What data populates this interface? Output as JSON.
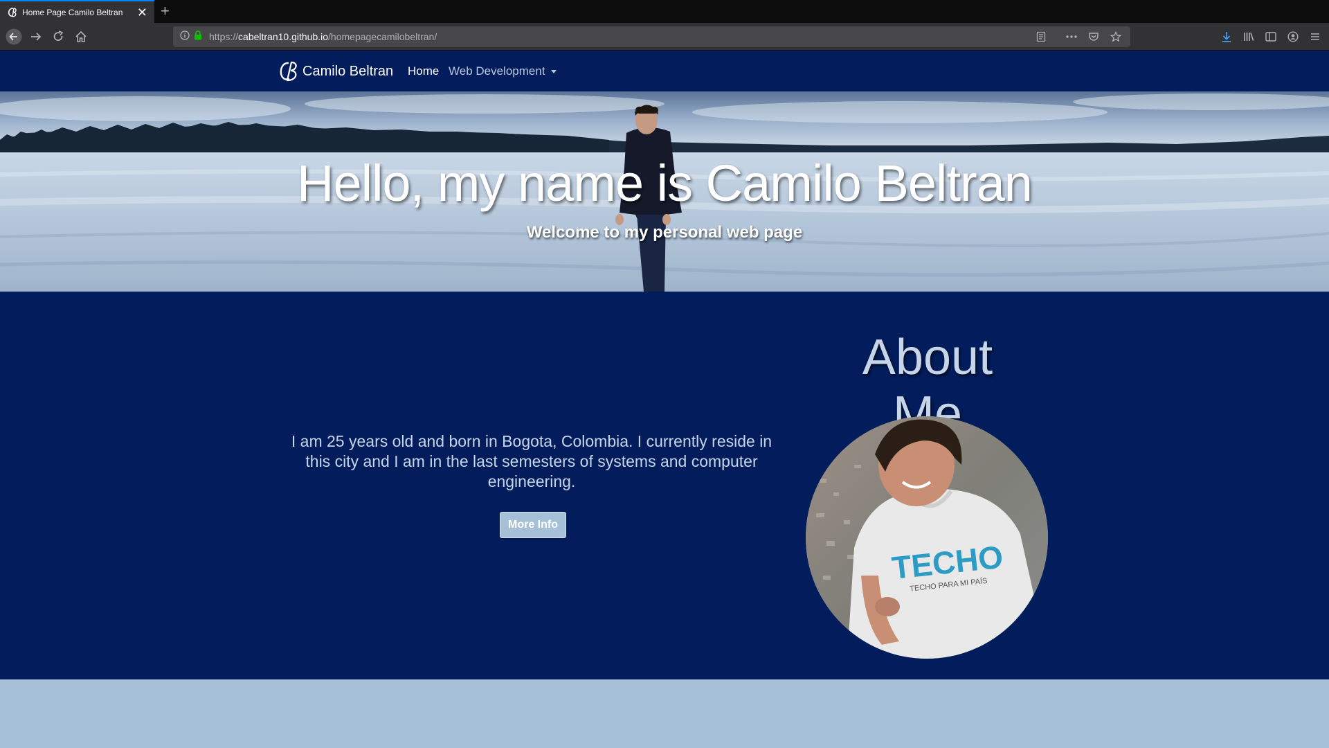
{
  "browser": {
    "tab_title": "Home Page Camilo Beltran",
    "url_prefix": "https://",
    "url_host": "cabeltran10.github.io",
    "url_path": "/homepagecamilobeltran/"
  },
  "navbar": {
    "brand": "Camilo Beltran",
    "home": "Home",
    "web_development": "Web Development"
  },
  "hero": {
    "title": "Hello, my name is Camilo Beltran",
    "subtitle": "Welcome to my personal web page"
  },
  "about": {
    "title": "About Me",
    "text": "I am 25 years old and born in Bogota, Colombia. I currently reside in this city and I am in the last semesters of systems and computer engineering.",
    "button": "More Info",
    "shirt_logo": "TECHO",
    "shirt_tagline": "TECHO PARA MI PAÍS"
  },
  "colors": {
    "navy": "#031d5c",
    "light_blue": "#a6c1d7",
    "text_light": "#c6d6e8",
    "tab_accent": "#0a84ff"
  }
}
